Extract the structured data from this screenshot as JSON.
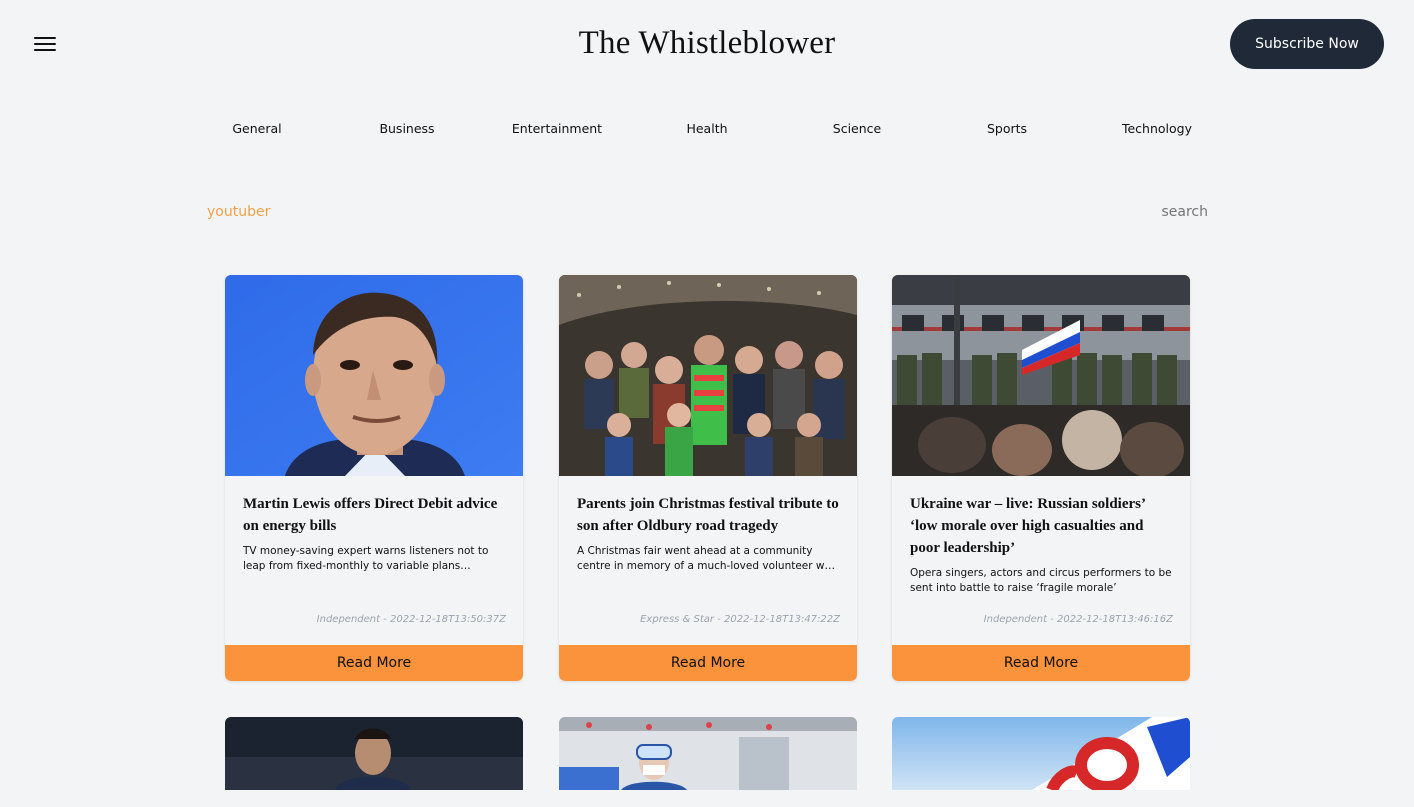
{
  "header": {
    "title": "The Whistleblower",
    "subscribe_label": "Subscribe Now"
  },
  "categories": [
    "General",
    "Business",
    "Entertainment",
    "Health",
    "Science",
    "Sports",
    "Technology"
  ],
  "search": {
    "query": "youtuber",
    "placeholder": "search"
  },
  "articles": [
    {
      "title": "Martin Lewis offers Direct Debit advice on energy bills",
      "description": "TV money-saving expert warns listeners not to leap from fixed-monthly to variable plans without…",
      "meta": "Independent - 2022-12-18T13:50:37Z",
      "read_more": "Read More"
    },
    {
      "title": "Parents join Christmas festival tribute to son after Oldbury road tragedy",
      "description": "A Christmas fair went ahead at a community centre in memory of a much-loved volunteer who was killed i…",
      "meta": "Express & Star - 2022-12-18T13:47:22Z",
      "read_more": "Read More"
    },
    {
      "title": "Ukraine war – live: Russian soldiers’ ‘low morale over high casualties and poor leadership’",
      "description": "Opera singers, actors and circus performers to be sent into battle to raise ‘fragile morale’",
      "meta": "Independent - 2022-12-18T13:46:16Z",
      "read_more": "Read More"
    }
  ],
  "colors": {
    "accent": "#fb923c",
    "query": "#f0a14a",
    "dark_button": "#1f2937",
    "background": "#f3f4f6"
  }
}
